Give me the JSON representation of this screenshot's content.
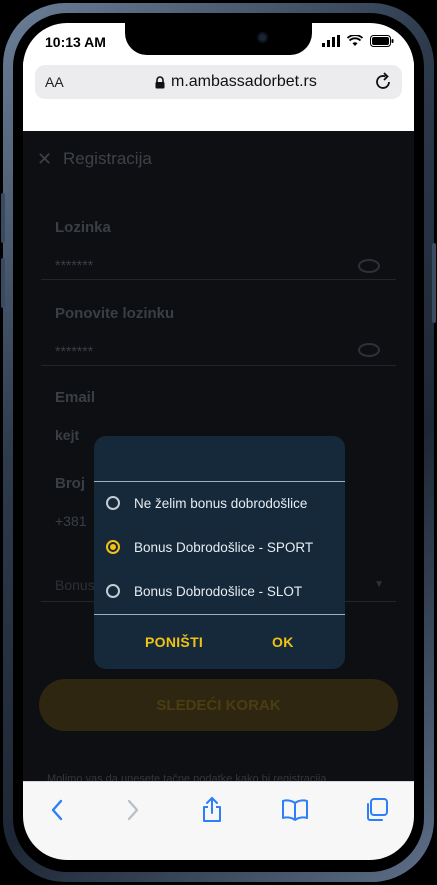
{
  "status": {
    "time": "10:13 AM"
  },
  "browser": {
    "aa": "AA",
    "url": "m.ambassadorbet.rs"
  },
  "page": {
    "title": "Registracija",
    "fields": [
      {
        "label": "Lozinka",
        "value": "*******"
      },
      {
        "label": "Ponovite lozinku",
        "value": "*******"
      },
      {
        "label": "Email",
        "value": "kejt"
      },
      {
        "label": "Broj",
        "value": "+381"
      }
    ],
    "bonus_placeholder": "Bonus",
    "next_button": "SLEDEĆI KORAK",
    "footnote": "Molimo vas da unesete tačne podatke kako bi registracija"
  },
  "dialog": {
    "options": [
      {
        "label": "Ne želim bonus dobrodošlice",
        "selected": false
      },
      {
        "label": "Bonus Dobrodošlice - SPORT",
        "selected": true
      },
      {
        "label": "Bonus Dobrodošlice - SLOT",
        "selected": false
      }
    ],
    "cancel": "PONIŠTI",
    "ok": "OK"
  },
  "colors": {
    "accent": "#f2c313",
    "dialog_bg": "#15293a",
    "ios_blue": "#2d7ff9"
  },
  "toolbar": {
    "icons": [
      "back-icon",
      "forward-icon",
      "share-icon",
      "bookmarks-icon",
      "tabs-icon"
    ]
  }
}
